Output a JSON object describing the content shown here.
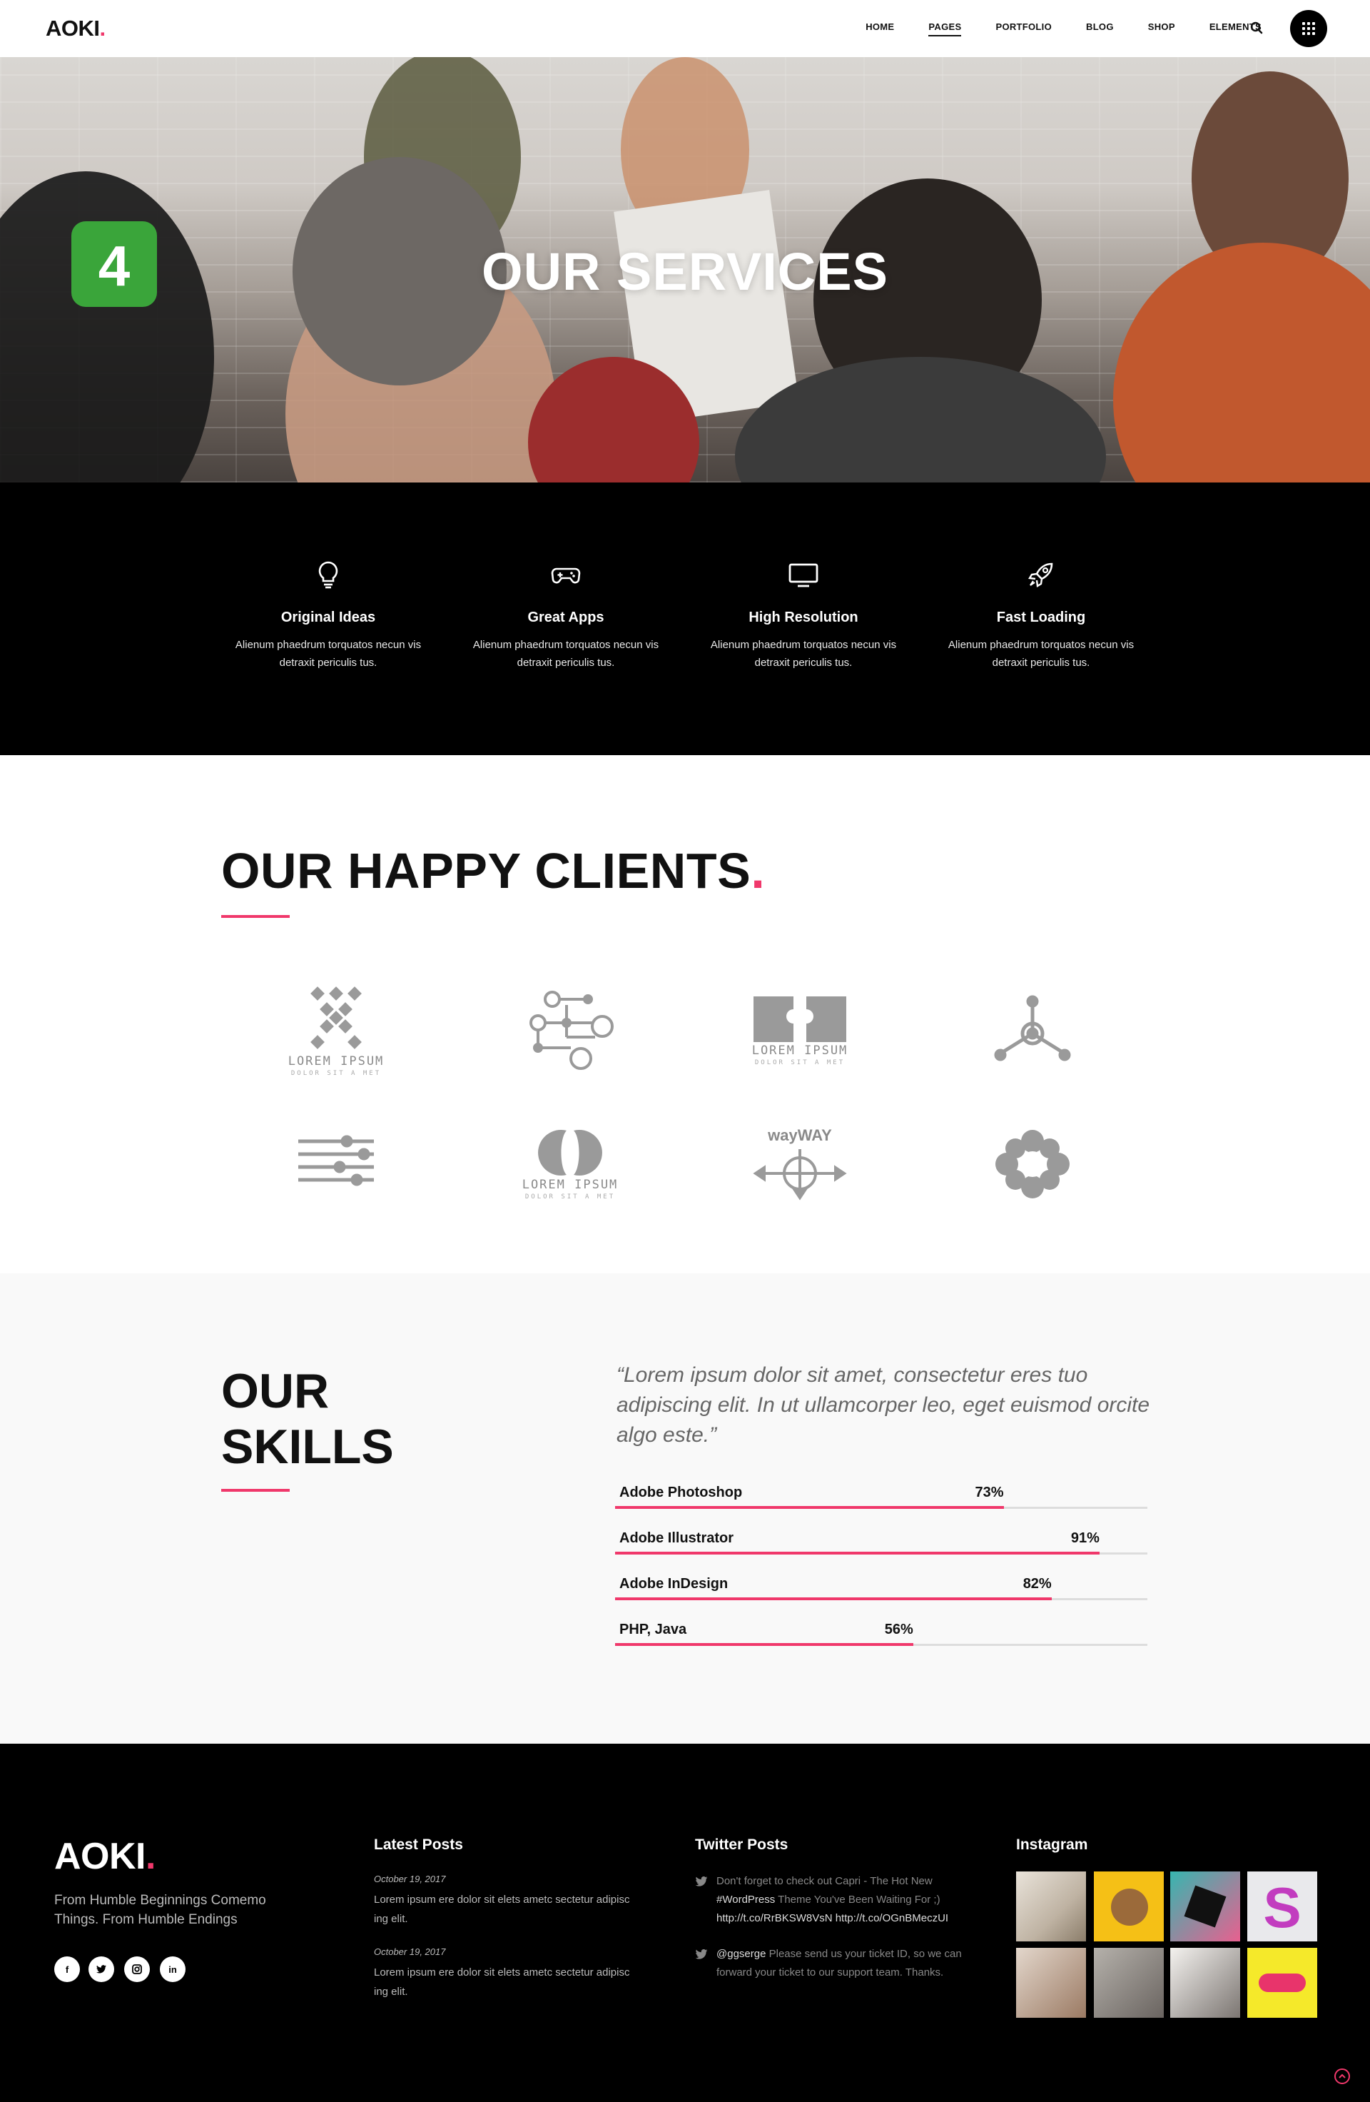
{
  "nav": {
    "logo": "AOKI",
    "logo_dot": ".",
    "menu": [
      "HOME",
      "PAGES",
      "PORTFOLIO",
      "BLOG",
      "SHOP",
      "ELEMENTS"
    ],
    "active_menu": "PAGES"
  },
  "hero": {
    "title": "OUR SERVICES"
  },
  "services": [
    {
      "icon": "lightbulb-icon",
      "title": "Original Ideas",
      "text": "Alienum phaedrum torquatos necun vis detraxit periculis tus."
    },
    {
      "icon": "gamepad-icon",
      "title": "Great Apps",
      "text": "Alienum phaedrum torquatos necun vis detraxit periculis tus."
    },
    {
      "icon": "monitor-icon",
      "title": "High Resolution",
      "text": "Alienum phaedrum torquatos necun vis detraxit periculis tus."
    },
    {
      "icon": "rocket-icon",
      "title": "Fast Loading",
      "text": "Alienum phaedrum torquatos necun vis detraxit periculis tus."
    }
  ],
  "clients": {
    "title": "OUR HAPPY CLIENTS",
    "title_dot": ".",
    "logos": [
      {
        "name": "client-logo-1",
        "caption": "LOREM IPSUM",
        "sub": "DOLOR SIT A MET"
      },
      {
        "name": "client-logo-2",
        "caption": "",
        "sub": ""
      },
      {
        "name": "client-logo-3",
        "caption": "LOREM IPSUM",
        "sub": "DOLOR SIT A MET"
      },
      {
        "name": "client-logo-4",
        "caption": "",
        "sub": ""
      },
      {
        "name": "client-logo-5",
        "caption": "",
        "sub": ""
      },
      {
        "name": "client-logo-6",
        "caption": "LOREM IPSUM",
        "sub": "DOLOR SIT A MET"
      },
      {
        "name": "client-logo-7",
        "caption": "wayWAY",
        "sub": ""
      },
      {
        "name": "client-logo-8",
        "caption": "",
        "sub": ""
      }
    ]
  },
  "skills": {
    "title_line1": "OUR",
    "title_line2": "SKILLS",
    "quote": "“Lorem ipsum dolor sit amet, consectetur eres tuo adipiscing elit. In ut ullamcorper leo, eget euismod orcite algo este.”",
    "items": [
      {
        "name": "Adobe Photoshop",
        "percent_label": "73%",
        "value": 73
      },
      {
        "name": "Adobe Illustrator",
        "percent_label": "91%",
        "value": 91
      },
      {
        "name": "Adobe InDesign",
        "percent_label": "82%",
        "value": 82
      },
      {
        "name": "PHP, Java",
        "percent_label": "56%",
        "value": 56
      }
    ]
  },
  "footer": {
    "logo": "AOKI",
    "logo_dot": ".",
    "tagline": "From Humble Beginnings Comemo Things. From Humble Endings",
    "social": [
      "f",
      "t",
      "ig",
      "in"
    ],
    "latest_posts_title": "Latest Posts",
    "posts": [
      {
        "date": "October 19, 2017",
        "text": "Lorem ipsum ere dolor sit elets ametc sectetur adipisc ing elit."
      },
      {
        "date": "October 19, 2017",
        "text": "Lorem ipsum ere dolor sit elets ametc sectetur adipisc ing elit."
      }
    ],
    "twitter_title": "Twitter Posts",
    "tweets": [
      {
        "text1": "Don't forget to check out Capri - The Hot New ",
        "hl1": "#WordPress",
        "text2": " Theme You've Been Waiting For ;) ",
        "hl2": "http://t.co/RrBKSW8VsN http://t.co/OGnBMeczUI"
      },
      {
        "hl1": "@ggserge",
        "text1": " Please send us your ticket ID, so we can forward your ticket to our support team. Thanks."
      }
    ],
    "instagram_title": "Instagram"
  },
  "colors": {
    "accent": "#f0386b",
    "dark": "#000000",
    "light_bg": "#f9f9f9"
  }
}
